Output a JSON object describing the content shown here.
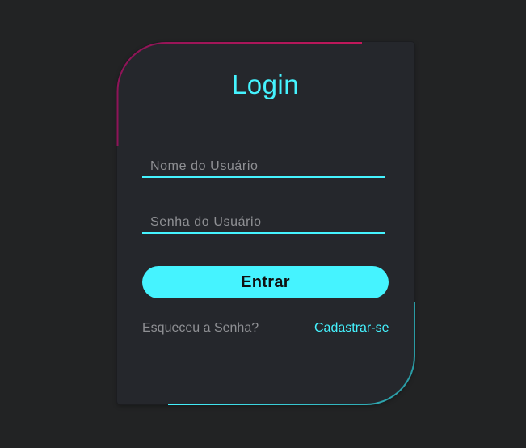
{
  "login": {
    "title": "Login",
    "username_placeholder": "Nome do Usuário",
    "password_placeholder": "Senha do Usuário",
    "submit_label": "Entrar",
    "forgot_link": "Esqueceu a Senha?",
    "signup_link": "Cadastrar-se"
  },
  "colors": {
    "accent": "#45f3ff",
    "accent_secondary": "#c2185b",
    "background": "#222324",
    "card": "#25272c",
    "muted_text": "#8f9094"
  }
}
